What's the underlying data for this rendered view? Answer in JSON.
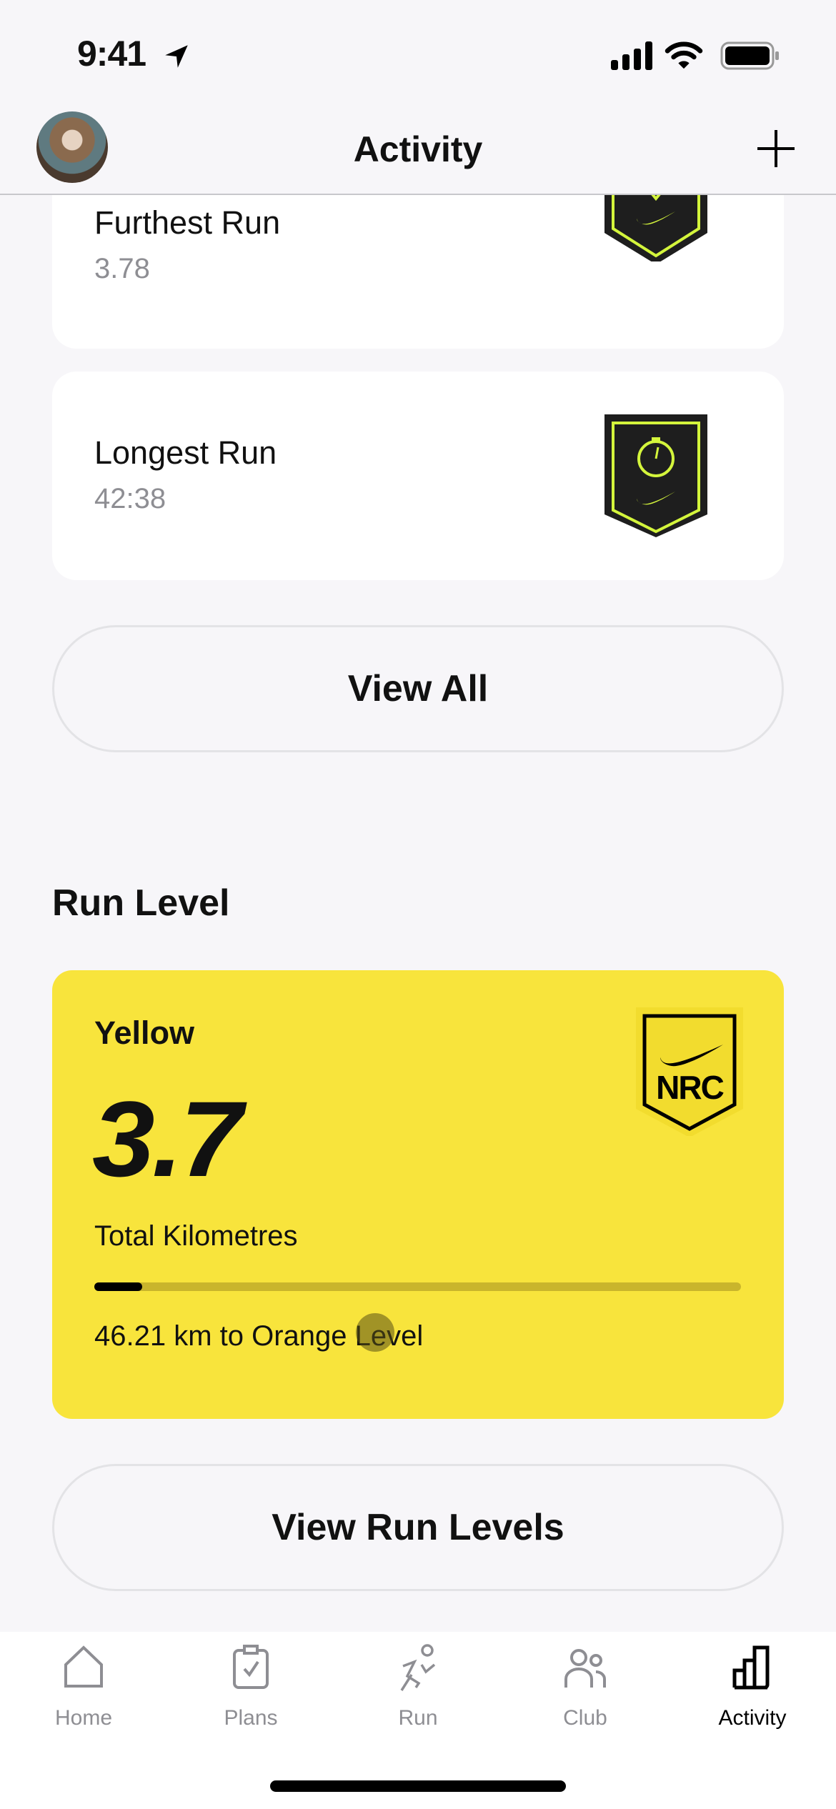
{
  "status_bar": {
    "time": "9:41"
  },
  "header": {
    "title": "Activity",
    "add_label": "+"
  },
  "records": [
    {
      "title": "Furthest Run",
      "value": "3.78",
      "badge_icon": "distance-arrow-icon"
    },
    {
      "title": "Longest Run",
      "value": "42:38",
      "badge_icon": "stopwatch-icon"
    }
  ],
  "view_all_label": "View All",
  "run_level": {
    "section_title": "Run Level",
    "level_name": "Yellow",
    "total_km": "3.7",
    "unit_label": "Total Kilometres",
    "progress_percent": 7.4,
    "next_level_text": "46.21 km to Orange Level",
    "badge_text": "NRC",
    "card_color": "#f8e43c"
  },
  "view_run_levels_label": "View Run Levels",
  "tabs": [
    {
      "label": "Home",
      "icon": "home-icon",
      "active": false
    },
    {
      "label": "Plans",
      "icon": "clipboard-check-icon",
      "active": false
    },
    {
      "label": "Run",
      "icon": "runner-icon",
      "active": false
    },
    {
      "label": "Club",
      "icon": "people-icon",
      "active": false
    },
    {
      "label": "Activity",
      "icon": "bar-chart-icon",
      "active": true
    }
  ],
  "colors": {
    "accent_volt": "#d4f53c",
    "badge_dark": "#1e1e1e",
    "inactive_tab": "#8e8e93"
  }
}
